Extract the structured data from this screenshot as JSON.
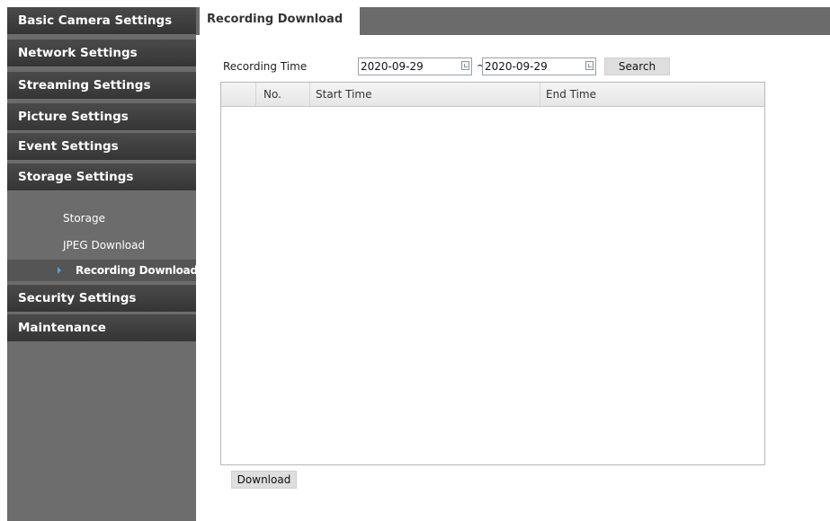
{
  "sidebar": {
    "nav": [
      {
        "label": "Basic Camera Settings"
      },
      {
        "label": "Network Settings"
      },
      {
        "label": "Streaming Settings"
      },
      {
        "label": "Picture Settings"
      },
      {
        "label": "Event Settings"
      },
      {
        "label": "Storage Settings"
      },
      {
        "label": "Security Settings"
      },
      {
        "label": "Maintenance"
      }
    ],
    "storage_sub": [
      {
        "label": "Storage"
      },
      {
        "label": "JPEG Download"
      },
      {
        "label": "Recording Download",
        "active": true
      }
    ]
  },
  "tab": {
    "label": "Recording Download"
  },
  "search": {
    "label": "Recording Time",
    "start_date": "2020-09-29",
    "separator": "~",
    "end_date": "2020-09-29",
    "button": "Search"
  },
  "table": {
    "columns": [
      "",
      "No.",
      "Start Time",
      "End Time"
    ],
    "rows": []
  },
  "download_button": "Download",
  "colors": {
    "sidebar_bg": "#6b6b6b",
    "nav_bg": "#3f3f3f",
    "active_arrow": "#4fa3d8"
  }
}
